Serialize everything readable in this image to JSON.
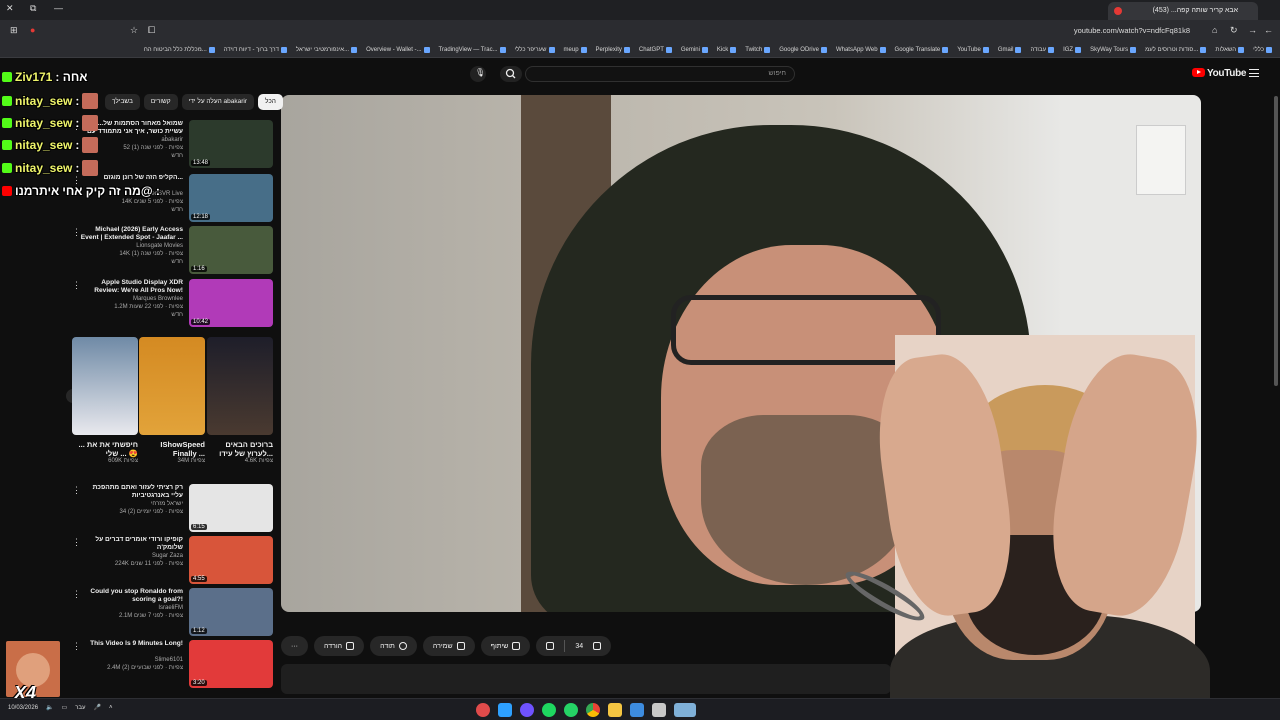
{
  "browser": {
    "tab_title": "אבא קריר שותה קפה... (453)",
    "url": "youtube.com/watch?v=ndfcFq81k8",
    "bookmarks": [
      "כללי",
      "השאלות",
      "סודות וטרוסים לעמ...",
      "SkyWay Tours",
      "IGZ",
      "עבודה",
      "Gmail",
      "YouTube",
      "Google Translate",
      "WhatsApp Web",
      "Google ODrive",
      "Twitch",
      "Kick",
      "Gemini",
      "ChatGPT",
      "Perplexity",
      "meup",
      "שעריפר כללי",
      "TradingView — Trac...",
      "Overview - Wallet -...",
      "אינפורמטיבי ישראל...",
      "דרך ברוך - דיווח דוידה",
      "מכללת כלל הביטוח הח..."
    ]
  },
  "youtube": {
    "logo_text": "YouTube",
    "search_placeholder": "חיפוש",
    "chips": [
      "הכל",
      "העלה על ידי abakarir",
      "קשורים",
      "בשבילך"
    ]
  },
  "recommendations": [
    {
      "title": "שמואל מאחור הסתמות של... עשיית כושר, איך אני מתמודד עם המלחמה...",
      "channel": "abakarir",
      "stats": "52 צפיות · לפני שנה (1)",
      "duration": "13:48",
      "badge": "חדש"
    },
    {
      "title": "הקליפ הזה של רונן מוגזם...",
      "channel": "SedSVR Live",
      "stats": "14K צפיות · לפני 5 שנים",
      "duration": "12:18",
      "badge": "חדש"
    },
    {
      "title": "Michael (2026) Early Access Event | Extended Spot - Jaafar ...",
      "channel": "Lionsgate Movies",
      "stats": "14K צפיות · לפני שנה (1)",
      "duration": "1:16",
      "badge": "חדש"
    },
    {
      "title": "Apple Studio Display XDR Review: We're All Pros Now!",
      "channel": "Marques Brownlee",
      "stats": "1.2M צפיות · לפני 22 שעות",
      "duration": "10:42",
      "badge": "חדש"
    },
    {
      "title": "רק רציתי לעזור ואתם מתהפכת עליי באנרגטיביות",
      "channel": "ישראל מזרחי",
      "stats": "34 צפיות · לפני יומיים (2)",
      "duration": "6:15",
      "badge": ""
    },
    {
      "title": "קופיקו ורודי אומרים דברים על שלומק'ה",
      "channel": "Sugar Zaza",
      "stats": "224K צפיות · לפני 11 שנים",
      "duration": "4:55",
      "badge": ""
    },
    {
      "title": "Could you stop Ronaldo from scoring a goal?!",
      "channel": "IsraeliFM",
      "stats": "2.1M צפיות · לפני 7 שנים",
      "duration": "1:12",
      "badge": ""
    },
    {
      "title": "This Video Is 9 Minutes Long!",
      "channel": "Slime6101",
      "stats": "2.4M צפיות · לפני שבועיים (2)",
      "duration": "3:20",
      "badge": ""
    }
  ],
  "shorts": [
    {
      "title": "ברוכים הבאים לערוץ של עידו...",
      "views": "4.6K צפיות"
    },
    {
      "title": "IShowSpeed Finally ...",
      "views": "34M צפיות"
    },
    {
      "title": "חיפשתי את את ... שלי ... 😍",
      "views": "609K צפיות"
    }
  ],
  "actions": {
    "like_count": "34",
    "share": "שיתוף",
    "save": "שמירה",
    "thanks": "תודה",
    "download": "הורדה",
    "more": "···"
  },
  "chat": [
    {
      "user": "Ziv171",
      "text": ": אחה",
      "platform": "kick"
    },
    {
      "user": "nitay_sew",
      "text": ":",
      "platform": "kick"
    },
    {
      "user": "nitay_sew",
      "text": ":",
      "platform": "kick"
    },
    {
      "user": "nitay_sew",
      "text": ":",
      "platform": "kick"
    },
    {
      "user": "nitay_sew",
      "text": ":",
      "platform": "kick"
    },
    {
      "user": "איתרמנו",
      "text": "מה זה קיק אחי@ :",
      "platform": "youtube"
    }
  ],
  "overlay": {
    "multiplier": "X4"
  },
  "taskbar": {
    "date": "10/03/2026",
    "lang": "עבר"
  }
}
